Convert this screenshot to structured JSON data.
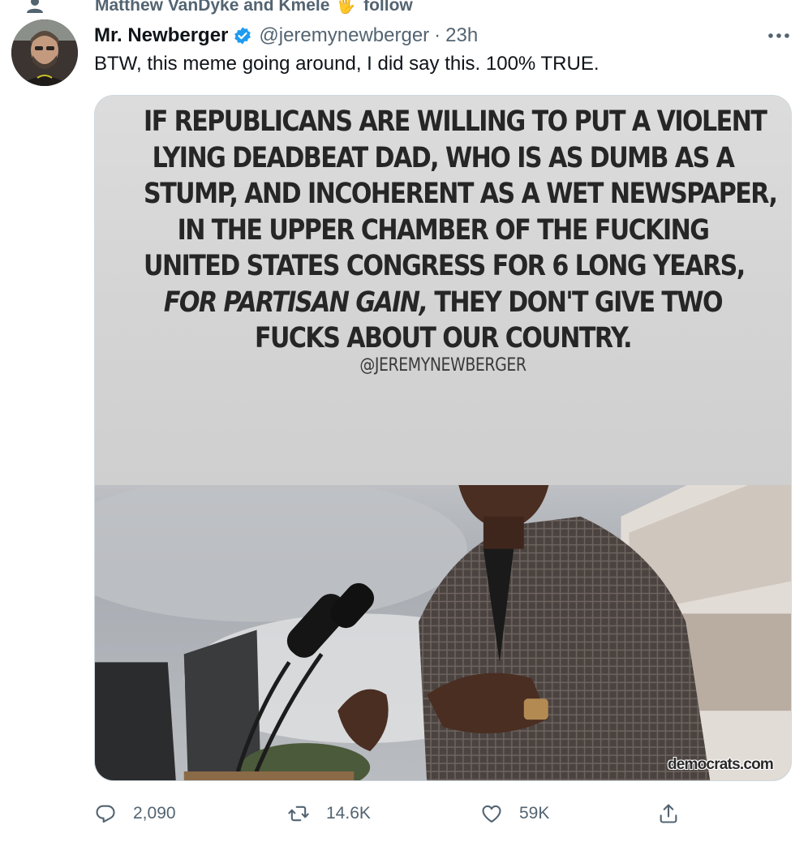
{
  "social_context": {
    "text": "Matthew VanDyke and Kmele",
    "emoji": "🖐",
    "follow_text": "follow"
  },
  "author": {
    "display_name": "Mr. Newberger",
    "handle": "@jeremynewberger",
    "separator": "·",
    "time": "23h"
  },
  "tweet_text": "BTW, this meme going around, I did say this. 100% TRUE.",
  "media": {
    "meme_lines": [
      "IF REPUBLICANS ARE WILLING TO PUT A VIOLENT",
      "LYING DEADBEAT DAD, WHO IS AS DUMB AS A",
      "STUMP, AND INCOHERENT AS A WET NEWSPAPER,",
      "IN THE UPPER CHAMBER OF THE FUCKING",
      "UNITED STATES CONGRESS FOR 6 LONG YEARS,"
    ],
    "meme_line6_italic": "FOR PARTISAN GAIN,",
    "meme_line6_rest": " THEY DON'T GIVE TWO",
    "meme_line7": "FUCKS ABOUT OUR COUNTRY.",
    "credit": "@JEREMYNEWBERGER",
    "watermark": "democrats.com"
  },
  "actions": {
    "reply_count": "2,090",
    "retweet_count": "14.6K",
    "like_count": "59K"
  },
  "icons": {
    "person": "person-icon",
    "verified": "verified-badge-icon",
    "more": "more-horizontal-icon",
    "reply": "reply-icon",
    "retweet": "retweet-icon",
    "like": "heart-icon",
    "share": "share-icon"
  },
  "colors": {
    "text_primary": "#0f1419",
    "text_secondary": "#536471",
    "verified_blue": "#1d9bf0"
  }
}
